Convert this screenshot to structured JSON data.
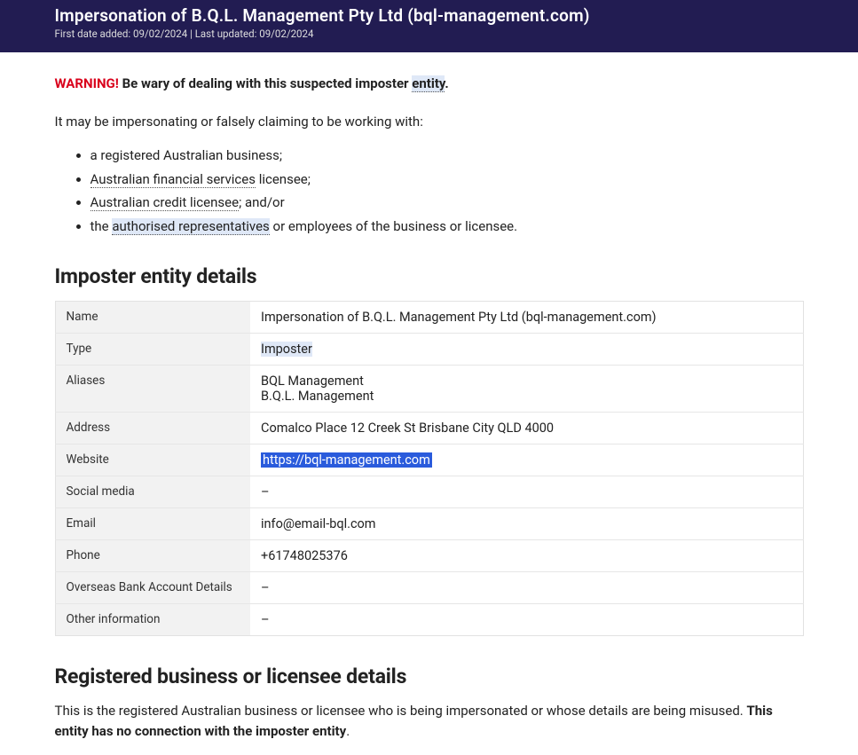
{
  "header": {
    "title": "Impersonation of B.Q.L. Management Pty Ltd (bql-management.com)",
    "meta": "First date added: 09/02/2024 | Last updated: 09/02/2024"
  },
  "warning": {
    "label": "WARNING!",
    "text_before_entity": "Be wary of dealing with this suspected imposter ",
    "entity_term": "entity",
    "text_after_entity": "."
  },
  "intro": "It may be impersonating or falsely claiming to be working with:",
  "bullets": {
    "b1": "a registered Australian business;",
    "b2_link": "Australian financial services",
    "b2_rest": " licensee;",
    "b3_link": "Australian credit licensee",
    "b3_rest": "; and/or",
    "b4_before": "the ",
    "b4_link": "authorised representatives",
    "b4_after": " or employees of the business or licensee."
  },
  "section1_heading": "Imposter entity details",
  "details": {
    "name_label": "Name",
    "name_value": "Impersonation of B.Q.L. Management Pty Ltd (bql-management.com)",
    "type_label": "Type",
    "type_value": "Imposter",
    "aliases_label": "Aliases",
    "aliases_line1": "BQL Management",
    "aliases_line2": "B.Q.L. Management",
    "address_label": "Address",
    "address_value": "Comalco Place 12 Creek St Brisbane City QLD 4000",
    "website_label": "Website",
    "website_value": "https://bql-management.com",
    "social_label": "Social media",
    "social_value": "–",
    "email_label": "Email",
    "email_value": "info@email-bql.com",
    "phone_label": "Phone",
    "phone_value": "+61748025376",
    "overseas_label": "Overseas Bank Account Details",
    "overseas_value": "–",
    "other_label": "Other information",
    "other_value": "–"
  },
  "section2_heading": "Registered business or licensee details",
  "registered": {
    "lead_plain": "This is the registered Australian business or licensee who is being impersonated or whose details are being misused. ",
    "lead_bold": "This entity has no connection with the imposter entity",
    "lead_end": "."
  }
}
